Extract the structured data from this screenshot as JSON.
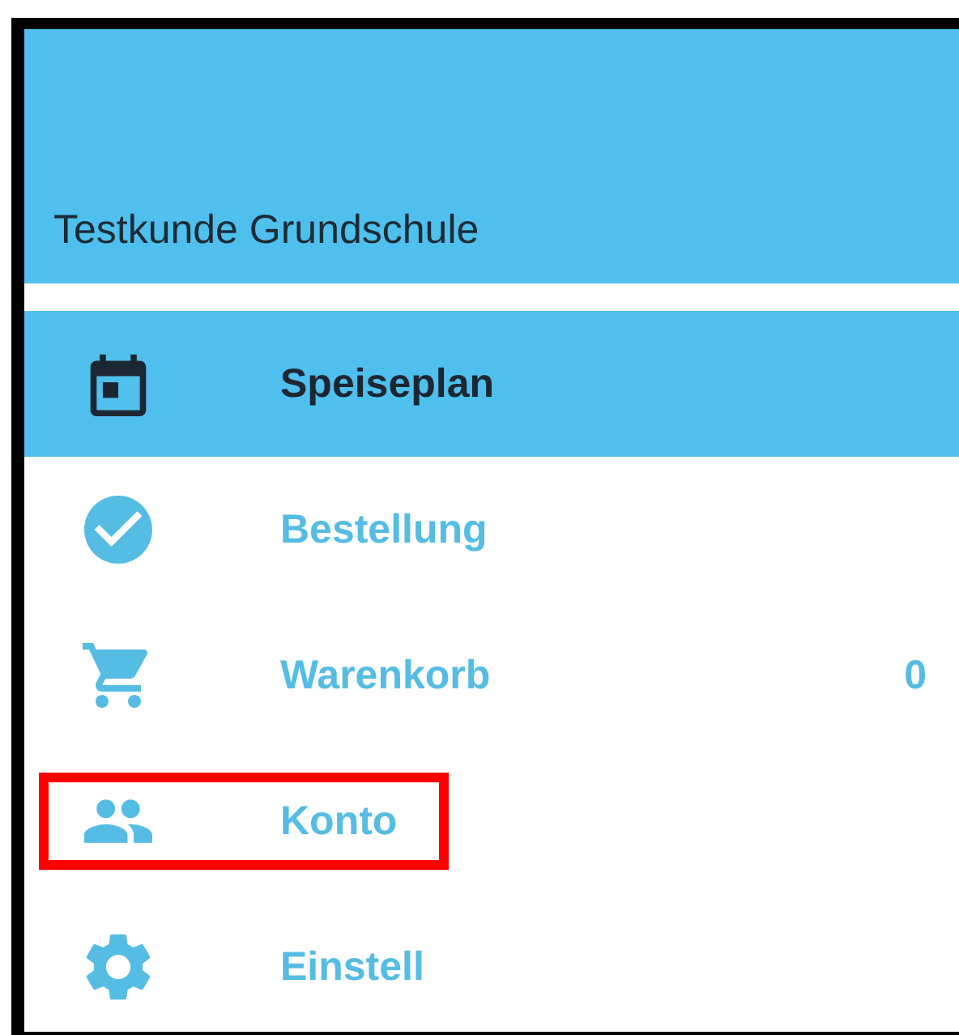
{
  "header": {
    "title": "Testkunde Grundschule"
  },
  "menu": [
    {
      "label": "Speiseplan",
      "selected": true,
      "highlighted": false
    },
    {
      "label": "Bestellung",
      "selected": false,
      "highlighted": false
    },
    {
      "label": "Warenkorb",
      "selected": false,
      "highlighted": false,
      "badge": "0"
    },
    {
      "label": "Konto",
      "selected": false,
      "highlighted": true
    },
    {
      "label": "Einstell",
      "selected": false,
      "highlighted": false
    }
  ]
}
